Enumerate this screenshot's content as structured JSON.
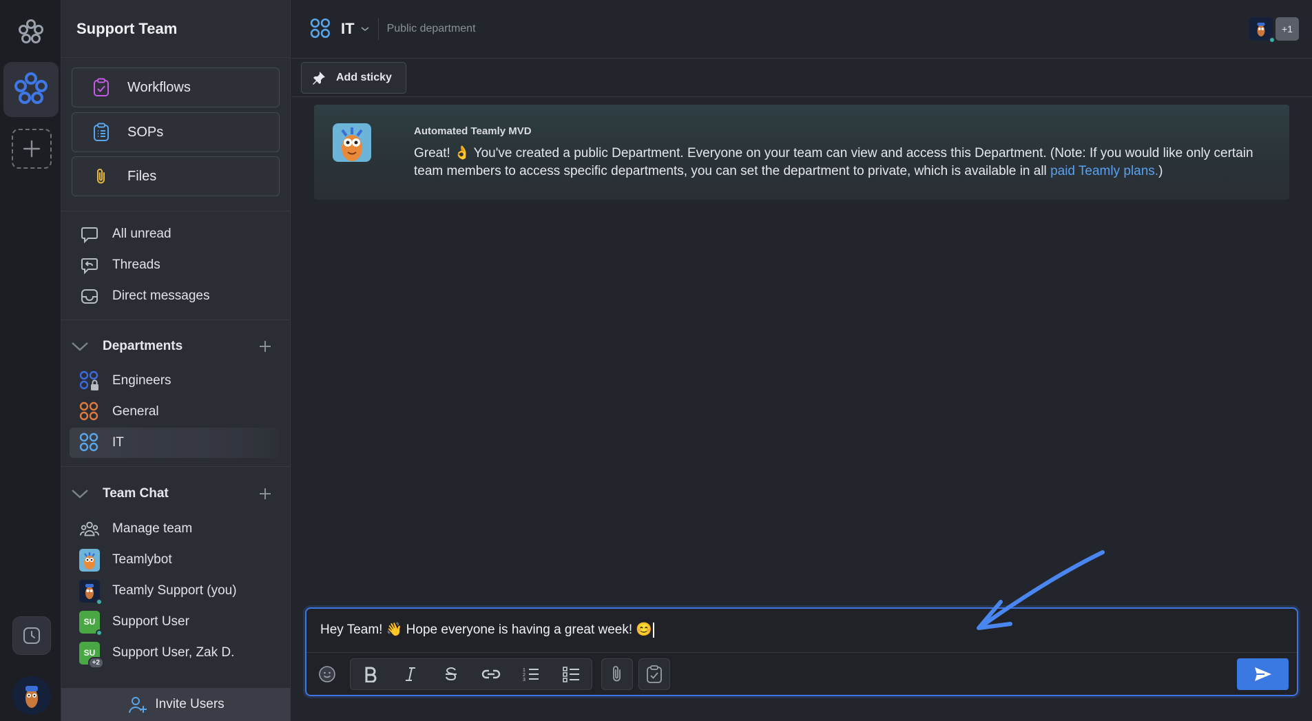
{
  "workspace": {
    "name": "Support Team"
  },
  "tools": [
    {
      "label": "Workflows",
      "icon": "workflow-clipboard-icon"
    },
    {
      "label": "SOPs",
      "icon": "sop-list-icon"
    },
    {
      "label": "Files",
      "icon": "paperclip-icon"
    }
  ],
  "nav": [
    {
      "label": "All unread",
      "icon": "chat-bubble-icon"
    },
    {
      "label": "Threads",
      "icon": "threads-icon"
    },
    {
      "label": "Direct messages",
      "icon": "inbox-icon"
    }
  ],
  "departments": {
    "title": "Departments",
    "items": [
      {
        "label": "Engineers",
        "color": "#3d6be0",
        "locked": true
      },
      {
        "label": "General",
        "color": "#e07a3d"
      },
      {
        "label": "IT",
        "color": "#5aa6ea",
        "active": true
      }
    ]
  },
  "team_chat": {
    "title": "Team Chat",
    "items": [
      {
        "label": "Manage team"
      },
      {
        "label": "Teamlybot"
      },
      {
        "label": "Teamly Support (you)"
      },
      {
        "label": "Support User",
        "initials": "SU"
      },
      {
        "label": "Support User, Zak D.",
        "initials": "SU",
        "extra": "+2"
      }
    ]
  },
  "invite_label": "Invite Users",
  "channel": {
    "name": "IT",
    "description": "Public department",
    "extra_members": "+1"
  },
  "add_sticky_label": "Add sticky",
  "message": {
    "author": "Automated Teamly MVD",
    "text_before": "Great! 👌 You've created a public Department. Everyone on your team can view and access this Department. (Note: If you would like only certain team members to access specific departments, you can set the department to private, which is available in all ",
    "link_text": "paid Teamly plans.",
    "text_after": ")"
  },
  "composer": {
    "value": "Hey Team! 👋 Hope everyone is having a great week! 😊"
  },
  "colors": {
    "accent": "#3a78e2",
    "link": "#5aa0ef",
    "online": "#3bb0a8",
    "su_green": "#4aa844"
  }
}
